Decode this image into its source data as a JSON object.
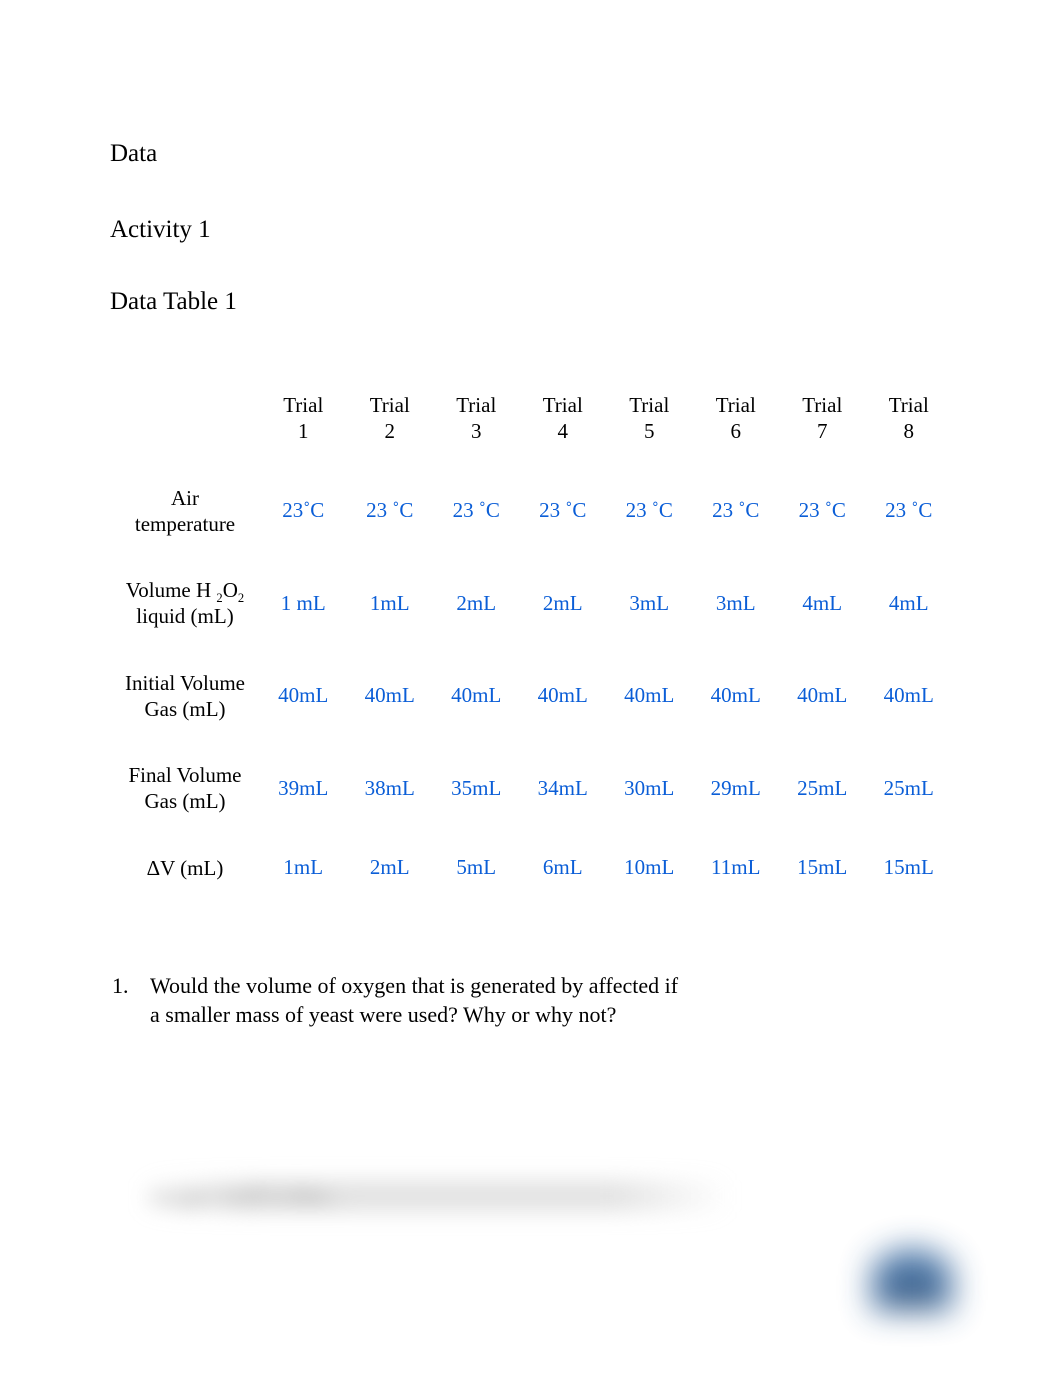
{
  "headings": {
    "data": "Data",
    "activity": "Activity 1",
    "table": "Data Table 1"
  },
  "table": {
    "columns": [
      "Trial 1",
      "Trial 2",
      "Trial 3",
      "Trial 4",
      "Trial 5",
      "Trial 6",
      "Trial 7",
      "Trial 8"
    ],
    "rows": [
      {
        "label": "Air temperature",
        "values": [
          "23˚C",
          "23 ˚C",
          "23 ˚C",
          "23 ˚C",
          "23 ˚C",
          "23 ˚C",
          "23 ˚C",
          "23 ˚C"
        ]
      },
      {
        "label_html": "Volume H ₂O₂ liquid (mL)",
        "label": "Volume H2O2 liquid (mL)",
        "values": [
          "1 mL",
          "1mL",
          "2mL",
          "2mL",
          "3mL",
          "3mL",
          "4mL",
          "4mL"
        ]
      },
      {
        "label": "Initial Volume Gas (mL)",
        "values": [
          "40mL",
          "40mL",
          "40mL",
          "40mL",
          "40mL",
          "40mL",
          "40mL",
          "40mL"
        ]
      },
      {
        "label": "Final Volume Gas (mL)",
        "values": [
          "39mL",
          "38mL",
          "35mL",
          "34mL",
          "30mL",
          "29mL",
          "25mL",
          "25mL"
        ]
      },
      {
        "label": "ΔV (mL)",
        "values": [
          "1mL",
          "2mL",
          "5mL",
          "6mL",
          "10mL",
          "11mL",
          "15mL",
          "15mL"
        ]
      }
    ]
  },
  "question": {
    "number": "1.",
    "text": "Would the volume of oxygen that is generated by affected if a smaller mass of yeast were used? Why or why not?"
  },
  "blurred_text": "oxygen itself is then…",
  "colors": {
    "value_color": "#0b5ed7"
  }
}
